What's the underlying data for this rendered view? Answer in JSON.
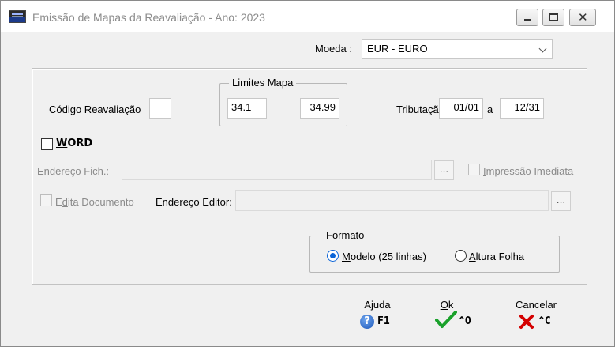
{
  "window": {
    "title": "Emissão de Mapas da Reavaliação - Ano: 2023",
    "close_glyph": "✕"
  },
  "moeda": {
    "label": "Moeda :",
    "value": "EUR - EURO"
  },
  "codigo_reavaliacao": {
    "label": "Código Reavaliação",
    "value": ""
  },
  "limites_mapa": {
    "title": "Limites Mapa",
    "from": "34.1",
    "to": "34.99"
  },
  "tributacao": {
    "label": "Tributação",
    "from": "01/01",
    "separator": "a",
    "to": "12/31"
  },
  "word": {
    "label_first": "W",
    "label_rest": "ORD",
    "checked": false
  },
  "endereco_fich": {
    "label": "Endereço Fich.:",
    "value": "",
    "browse": "..."
  },
  "impressao_imediata": {
    "label_first": "I",
    "label_rest": "mpressão Imediata",
    "checked": false
  },
  "edita_documento": {
    "label_first": "E",
    "label_mid": "d",
    "label_rest": "ita Documento",
    "checked": false
  },
  "endereco_editor": {
    "label": "Endereço Editor:",
    "value": "",
    "browse": "..."
  },
  "formato": {
    "title": "Formato",
    "option1": {
      "first": "M",
      "rest": "odelo (25 linhas)",
      "selected": true
    },
    "option2": {
      "first": "A",
      "rest": "ltura Folha",
      "selected": false
    }
  },
  "actions": {
    "ajuda": {
      "label": "Ajuda",
      "key": "F1",
      "icon": "help-icon"
    },
    "ok": {
      "label_first": "O",
      "label_rest": "k",
      "key": "^O",
      "icon": "checkmark-icon"
    },
    "cancelar": {
      "label": "Cancelar",
      "key": "^C",
      "icon": "cross-icon"
    }
  },
  "colors": {
    "accent": "#0a64d8",
    "ok": "#1aa12b",
    "cancel": "#d40000"
  }
}
